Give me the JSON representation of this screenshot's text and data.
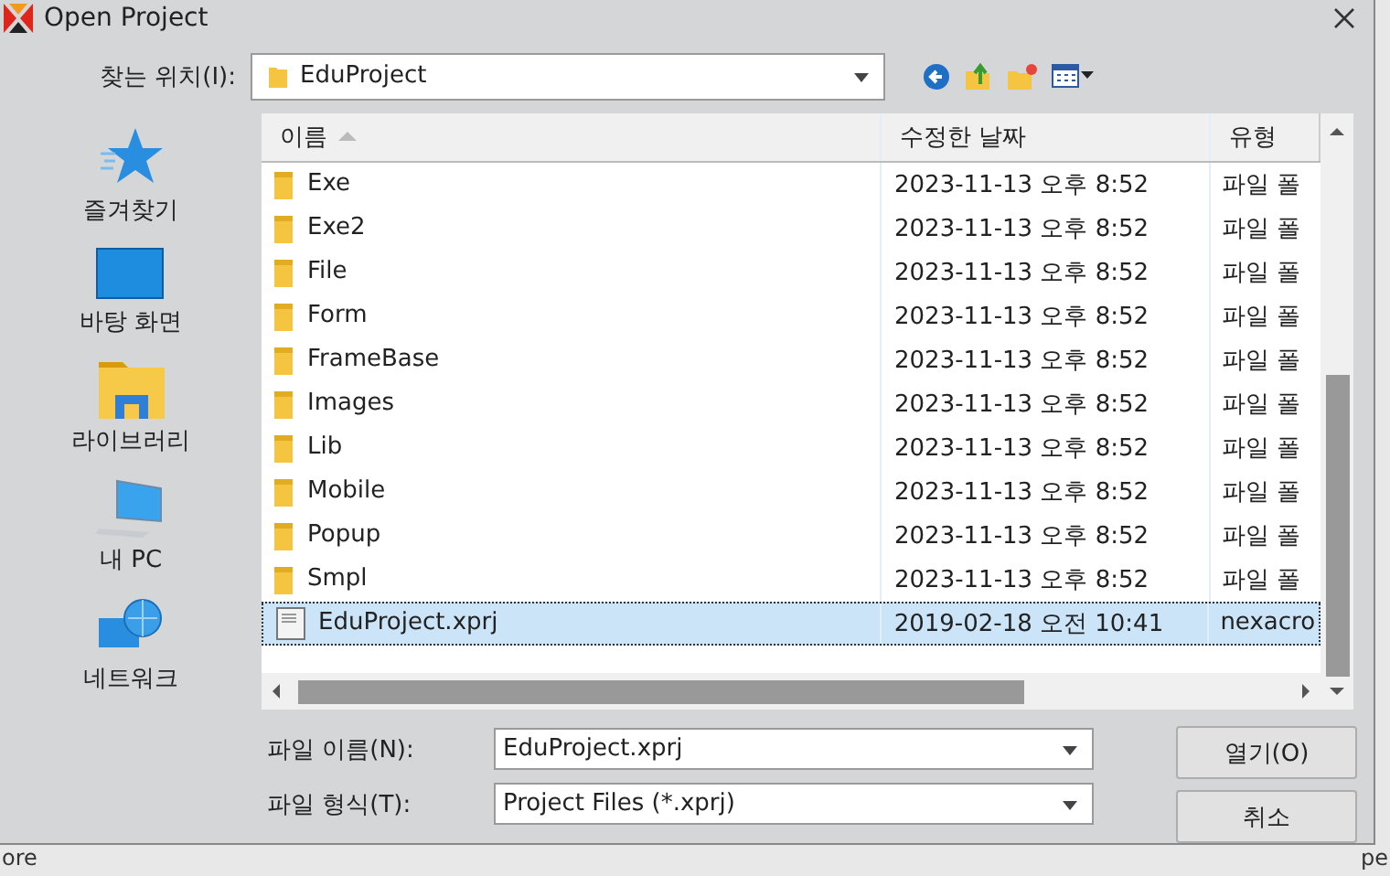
{
  "window": {
    "title": "Open Project"
  },
  "location": {
    "label": "찾는 위치(I):",
    "value": "EduProject"
  },
  "sidebar": {
    "items": [
      {
        "label": "즐겨찾기",
        "kind": "star"
      },
      {
        "label": "바탕 화면",
        "kind": "desktop"
      },
      {
        "label": "라이브러리",
        "kind": "library"
      },
      {
        "label": "내 PC",
        "kind": "pc"
      },
      {
        "label": "네트워크",
        "kind": "network"
      }
    ]
  },
  "table": {
    "columns": [
      {
        "label": "이름",
        "sorted": true
      },
      {
        "label": "수정한 날짜",
        "sorted": false
      },
      {
        "label": "유형",
        "sorted": false
      }
    ],
    "rows": [
      {
        "name": "Exe",
        "date": "2023-11-13 오후 8:52",
        "type": "파일 폴",
        "kind": "folder",
        "selected": false
      },
      {
        "name": "Exe2",
        "date": "2023-11-13 오후 8:52",
        "type": "파일 폴",
        "kind": "folder",
        "selected": false
      },
      {
        "name": "File",
        "date": "2023-11-13 오후 8:52",
        "type": "파일 폴",
        "kind": "folder",
        "selected": false
      },
      {
        "name": "Form",
        "date": "2023-11-13 오후 8:52",
        "type": "파일 폴",
        "kind": "folder",
        "selected": false
      },
      {
        "name": "FrameBase",
        "date": "2023-11-13 오후 8:52",
        "type": "파일 폴",
        "kind": "folder",
        "selected": false
      },
      {
        "name": "Images",
        "date": "2023-11-13 오후 8:52",
        "type": "파일 폴",
        "kind": "folder",
        "selected": false
      },
      {
        "name": "Lib",
        "date": "2023-11-13 오후 8:52",
        "type": "파일 폴",
        "kind": "folder",
        "selected": false
      },
      {
        "name": "Mobile",
        "date": "2023-11-13 오후 8:52",
        "type": "파일 폴",
        "kind": "folder",
        "selected": false
      },
      {
        "name": "Popup",
        "date": "2023-11-13 오후 8:52",
        "type": "파일 폴",
        "kind": "folder",
        "selected": false
      },
      {
        "name": "Smpl",
        "date": "2023-11-13 오후 8:52",
        "type": "파일 폴",
        "kind": "folder",
        "selected": false
      },
      {
        "name": "EduProject.xprj",
        "date": "2019-02-18 오전 10:41",
        "type": "nexacro",
        "kind": "file",
        "selected": true
      }
    ]
  },
  "file_name": {
    "label": "파일 이름(N):",
    "value": "EduProject.xprj"
  },
  "file_type": {
    "label": "파일 형식(T):",
    "value": "Project Files (*.xprj)"
  },
  "buttons": [
    "열기(O)",
    "취소"
  ],
  "background": {
    "left_text": "ore",
    "right_text": "pe"
  }
}
